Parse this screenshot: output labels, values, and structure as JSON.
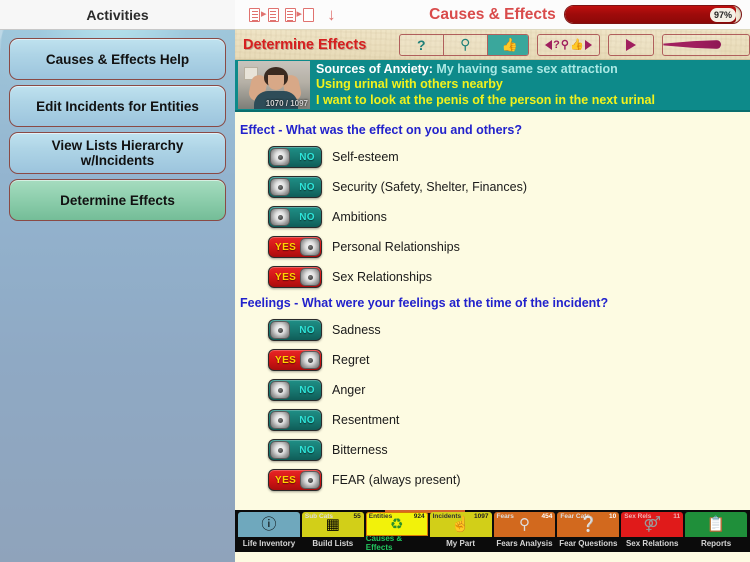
{
  "sidebar": {
    "title": "Activities",
    "buttons": [
      {
        "label": "Causes & Effects Help",
        "selected": false
      },
      {
        "label": "Edit Incidents for Entities",
        "selected": false
      },
      {
        "label": "View Lists Hierarchy w/Incidents",
        "selected": false
      },
      {
        "label": "Determine Effects",
        "selected": true
      }
    ]
  },
  "toolbar": {
    "title": "Causes & Effects",
    "icons": [
      "doc-transfer-in-icon",
      "doc-transfer-out-icon",
      "down-arrow-icon"
    ],
    "progress_label": "97%",
    "progress_percent": 97
  },
  "subbar": {
    "title": "Determine Effects",
    "help_glyph": "?",
    "search_glyph": "search-icon",
    "thumb_glyph": "thumbs-up-icon",
    "nav_back_glyph": "◀",
    "nav_q_glyph": "?",
    "nav_search_glyph": "search-icon",
    "nav_thumb_glyph": "thumbs-up-icon",
    "nav_fwd_glyph": "▶",
    "play_glyph": "play-icon",
    "wand_glyph": "wand-icon"
  },
  "banner": {
    "source_label": "Sources of Anxiety:",
    "source_value": "My having same sex attraction",
    "line2": "Using urinal with others nearby",
    "line3": "I want to look at the penis of the person in the next urinal",
    "counter": "1070 / 1097"
  },
  "sections": [
    {
      "question": "Effect - What was the effect on you and others?",
      "options": [
        {
          "label": "Self-esteem",
          "state": "NO"
        },
        {
          "label": "Security (Safety, Shelter, Finances)",
          "state": "NO"
        },
        {
          "label": "Ambitions",
          "state": "NO"
        },
        {
          "label": "Personal Relationships",
          "state": "YES"
        },
        {
          "label": "Sex Relationships",
          "state": "YES"
        }
      ]
    },
    {
      "question": "Feelings - What were your feelings at the time of the incident?",
      "options": [
        {
          "label": "Sadness",
          "state": "NO"
        },
        {
          "label": "Regret",
          "state": "YES"
        },
        {
          "label": "Anger",
          "state": "NO"
        },
        {
          "label": "Resentment",
          "state": "NO"
        },
        {
          "label": "Bitterness",
          "state": "NO"
        },
        {
          "label": "FEAR (always present)",
          "state": "YES"
        }
      ]
    }
  ],
  "tabbar": {
    "tabs": [
      {
        "name": "Life Inventory",
        "badge_left": "",
        "badge_right": "",
        "icon": "info-icon",
        "color": "#6fa8bd",
        "active": false
      },
      {
        "name": "Build Lists",
        "badge_left": "Sub Cats",
        "badge_right": "55",
        "icon": "blocks-icon",
        "color": "#d2cf18",
        "active": false
      },
      {
        "name": "Causes & Effects",
        "badge_left": "Entities",
        "badge_right": "924",
        "icon": "recycle-icon",
        "color": "#f2f20a",
        "active": true
      },
      {
        "name": "My Part",
        "badge_left": "Incidents",
        "badge_right": "1097",
        "icon": "hand-icon",
        "color": "#d2cf18",
        "active": false
      },
      {
        "name": "Fears Analysis",
        "badge_left": "Fears",
        "badge_right": "454",
        "icon": "magnifier-icon",
        "color": "#d2691e",
        "active": false
      },
      {
        "name": "Fear Questions",
        "badge_left": "Fear Cats",
        "badge_right": "10",
        "icon": "question-icon",
        "color": "#d2691e",
        "active": false
      },
      {
        "name": "Sex Relations",
        "badge_left": "Sex Rels",
        "badge_right": "11",
        "icon": "gender-icon",
        "color": "#e01a1a",
        "active": false
      },
      {
        "name": "Reports",
        "badge_left": "",
        "badge_right": "",
        "icon": "clipboard-icon",
        "color": "#1f8f3a",
        "active": false
      }
    ]
  },
  "colors": {
    "accent_red": "#d94b4b",
    "teal": "#0d8a8a",
    "question_blue": "#2222cc",
    "yellow_text": "#f2f21c"
  }
}
